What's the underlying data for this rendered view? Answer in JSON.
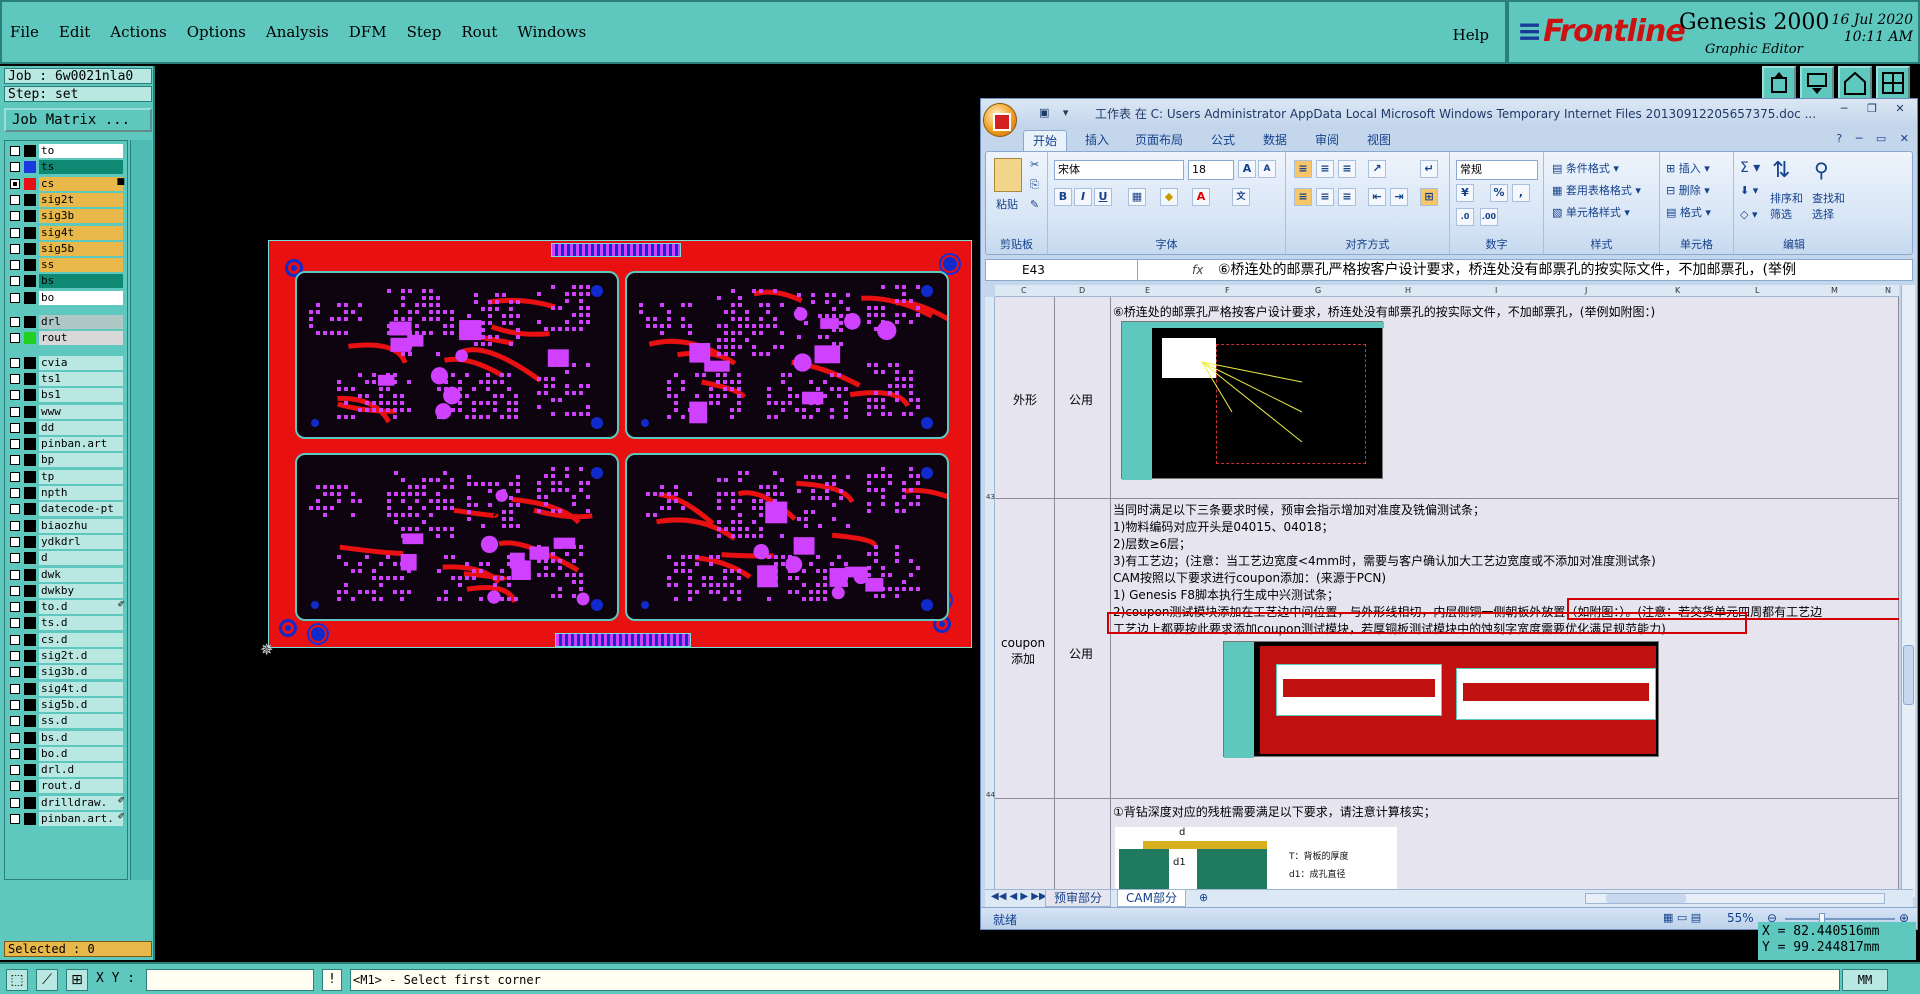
{
  "menu": {
    "items": [
      "File",
      "Edit",
      "Actions",
      "Options",
      "Analysis",
      "DFM",
      "Step",
      "Rout",
      "Windows"
    ],
    "help": "Help"
  },
  "brand": {
    "logo": "Frontline",
    "product": "Genesis 2000",
    "subtitle": "Graphic Editor",
    "date": "16 Jul 2020",
    "time": "10:11 AM"
  },
  "job": {
    "job_label": "Job : 6w0021nla0",
    "step_label": "Step: set",
    "matrix_button": "Job Matrix ..."
  },
  "layers": [
    {
      "name": "to",
      "color": "#ffffff",
      "swatch": "#000000",
      "checked": false
    },
    {
      "name": "ts",
      "color": "#0e8a74",
      "swatch": "#1a3ae0",
      "checked": false
    },
    {
      "name": "cs",
      "color": "#e8b84a",
      "swatch": "#e81010",
      "checked": true,
      "flag": "■"
    },
    {
      "name": "sig2t",
      "color": "#e8b84a",
      "swatch": "#000000",
      "checked": false
    },
    {
      "name": "sig3b",
      "color": "#e8b84a",
      "swatch": "#000000",
      "checked": false
    },
    {
      "name": "sig4t",
      "color": "#e8b84a",
      "swatch": "#000000",
      "checked": false
    },
    {
      "name": "sig5b",
      "color": "#e8b84a",
      "swatch": "#000000",
      "checked": false
    },
    {
      "name": "ss",
      "color": "#e8b84a",
      "swatch": "#000000",
      "checked": false
    },
    {
      "name": "bs",
      "color": "#0e8a74",
      "swatch": "#000000",
      "checked": false
    },
    {
      "name": "bo",
      "color": "#ffffff",
      "swatch": "#000000",
      "checked": false
    },
    {
      "name": "drl",
      "color": "#aec8c6",
      "swatch": "#000000",
      "checked": false
    },
    {
      "name": "rout",
      "color": "#d8d8d8",
      "swatch": "#22d022",
      "checked": false
    },
    {
      "name": "cvia",
      "color": "#b9e7e2",
      "swatch": "#000000",
      "checked": false
    },
    {
      "name": "ts1",
      "color": "#b9e7e2",
      "swatch": "#000000",
      "checked": false
    },
    {
      "name": "bs1",
      "color": "#b9e7e2",
      "swatch": "#000000",
      "checked": false
    },
    {
      "name": "www",
      "color": "#b9e7e2",
      "swatch": "#000000",
      "checked": false
    },
    {
      "name": "dd",
      "color": "#b9e7e2",
      "swatch": "#000000",
      "checked": false
    },
    {
      "name": "pinban.art",
      "color": "#b9e7e2",
      "swatch": "#000000",
      "checked": false
    },
    {
      "name": "bp",
      "color": "#b9e7e2",
      "swatch": "#000000",
      "checked": false
    },
    {
      "name": "tp",
      "color": "#b9e7e2",
      "swatch": "#000000",
      "checked": false
    },
    {
      "name": "npth",
      "color": "#b9e7e2",
      "swatch": "#000000",
      "checked": false
    },
    {
      "name": "datecode-pt",
      "color": "#b9e7e2",
      "swatch": "#000000",
      "checked": false
    },
    {
      "name": "biaozhu",
      "color": "#b9e7e2",
      "swatch": "#000000",
      "checked": false
    },
    {
      "name": "ydkdrl",
      "color": "#b9e7e2",
      "swatch": "#000000",
      "checked": false
    },
    {
      "name": "d",
      "color": "#b9e7e2",
      "swatch": "#000000",
      "checked": false
    },
    {
      "name": "dwk",
      "color": "#b9e7e2",
      "swatch": "#000000",
      "checked": false
    },
    {
      "name": "dwkby",
      "color": "#b9e7e2",
      "swatch": "#000000",
      "checked": false
    },
    {
      "name": "to.d",
      "color": "#b9e7e2",
      "swatch": "#000000",
      "checked": false,
      "flag": "✐"
    },
    {
      "name": "ts.d",
      "color": "#b9e7e2",
      "swatch": "#000000",
      "checked": false
    },
    {
      "name": "cs.d",
      "color": "#b9e7e2",
      "swatch": "#000000",
      "checked": false
    },
    {
      "name": "sig2t.d",
      "color": "#b9e7e2",
      "swatch": "#000000",
      "checked": false
    },
    {
      "name": "sig3b.d",
      "color": "#b9e7e2",
      "swatch": "#000000",
      "checked": false
    },
    {
      "name": "sig4t.d",
      "color": "#b9e7e2",
      "swatch": "#000000",
      "checked": false
    },
    {
      "name": "sig5b.d",
      "color": "#b9e7e2",
      "swatch": "#000000",
      "checked": false
    },
    {
      "name": "ss.d",
      "color": "#b9e7e2",
      "swatch": "#000000",
      "checked": false
    },
    {
      "name": "bs.d",
      "color": "#b9e7e2",
      "swatch": "#000000",
      "checked": false
    },
    {
      "name": "bo.d",
      "color": "#b9e7e2",
      "swatch": "#000000",
      "checked": false
    },
    {
      "name": "drl.d",
      "color": "#b9e7e2",
      "swatch": "#000000",
      "checked": false
    },
    {
      "name": "rout.d",
      "color": "#b9e7e2",
      "swatch": "#000000",
      "checked": false
    },
    {
      "name": "drilldraw.",
      "color": "#b9e7e2",
      "swatch": "#000000",
      "checked": false,
      "flag": "✐"
    },
    {
      "name": "pinban.art.",
      "color": "#b9e7e2",
      "swatch": "#000000",
      "checked": false,
      "flag": "✐"
    }
  ],
  "selected": "Selected : 0",
  "statusbar": {
    "xy_label": "X Y :",
    "xy_value": "",
    "prompt": "<M1> - Select first corner",
    "units": "MM"
  },
  "coords": {
    "x": "X = 82.440516mm",
    "y": "Y = 99.244817mm"
  },
  "excel": {
    "title": "工作表 在 C: Users Administrator AppData Local Microsoft Windows Temporary Internet Files 20130912205657375.doc ...",
    "tabs": [
      "开始",
      "插入",
      "页面布局",
      "公式",
      "数据",
      "审阅",
      "视图"
    ],
    "active_tab": "开始",
    "ribbon": {
      "clipboard": {
        "label": "剪贴板",
        "paste": "粘贴"
      },
      "font": {
        "label": "字体",
        "name": "宋体",
        "size": "18"
      },
      "alignment": {
        "label": "对齐方式"
      },
      "number": {
        "label": "数字",
        "format": "常规"
      },
      "styles": {
        "label": "样式",
        "conditional": "条件格式",
        "table": "套用表格格式",
        "cell": "单元格样式"
      },
      "cells": {
        "label": "单元格",
        "insert": "插入",
        "delete": "删除",
        "format": "格式"
      },
      "editing": {
        "label": "编辑",
        "sort": "排序和",
        "sort2": "筛选",
        "find": "查找和",
        "find2": "选择"
      }
    },
    "namebox": "E43",
    "formula": "⑥桥连处的邮票孔严格按客户设计要求，桥连处没有邮票孔的按实际文件，不加邮票孔，(举例",
    "columns": [
      "C",
      "D",
      "E",
      "F",
      "G",
      "H",
      "I",
      "J",
      "K",
      "L",
      "M",
      "N"
    ],
    "rows": [
      "43",
      "44"
    ],
    "row1": {
      "category": "外形",
      "scope": "公用",
      "text": "⑥桥连处的邮票孔严格按客户设计要求，桥连处没有邮票孔的按实际文件，不加邮票孔，(举例如附图：)"
    },
    "row2": {
      "category": "coupon\n添加",
      "scope": "公用",
      "lines": [
        "当同时满足以下三条要求时候，预审会指示增加对准度及铣偏测试条；",
        "1)物料编码对应开头是04015、04018；",
        "2)层数≥6层；",
        "3)有工艺边；(注意：当工艺边宽度<4mm时，需要与客户确认加大工艺边宽度或不添加对准度测试条)",
        "CAM按照以下要求进行coupon添加：(来源于PCN)",
        "1) Genesis F8脚本执行生成中兴测试条；",
        "2)coupon测试模块添加在工艺边中间位置，与外形线相切，内层侧铜一侧朝板外放置（如附图：）。(注意：若交货单元四周都有工艺边",
        "工艺边上都要按此要求添加coupon测试模块，若厚铜板测试模块中的蚀刻字宽度需要优化满足规范能力)"
      ]
    },
    "row3": {
      "text": "①背钻深度对应的残桩需要满足以下要求，请注意计算核实；",
      "diagram_labels": [
        "d",
        "d1",
        "T：背板的厚度",
        "d1：成孔直径"
      ]
    },
    "sheets": [
      "预审部分",
      "CAM部分"
    ],
    "status_ready": "就绪",
    "zoom": "55%"
  },
  "colors": {
    "genesis_bg": "#5ec8bf",
    "copper": "#e81010",
    "pad": "#d040ff",
    "via": "#102acc"
  }
}
